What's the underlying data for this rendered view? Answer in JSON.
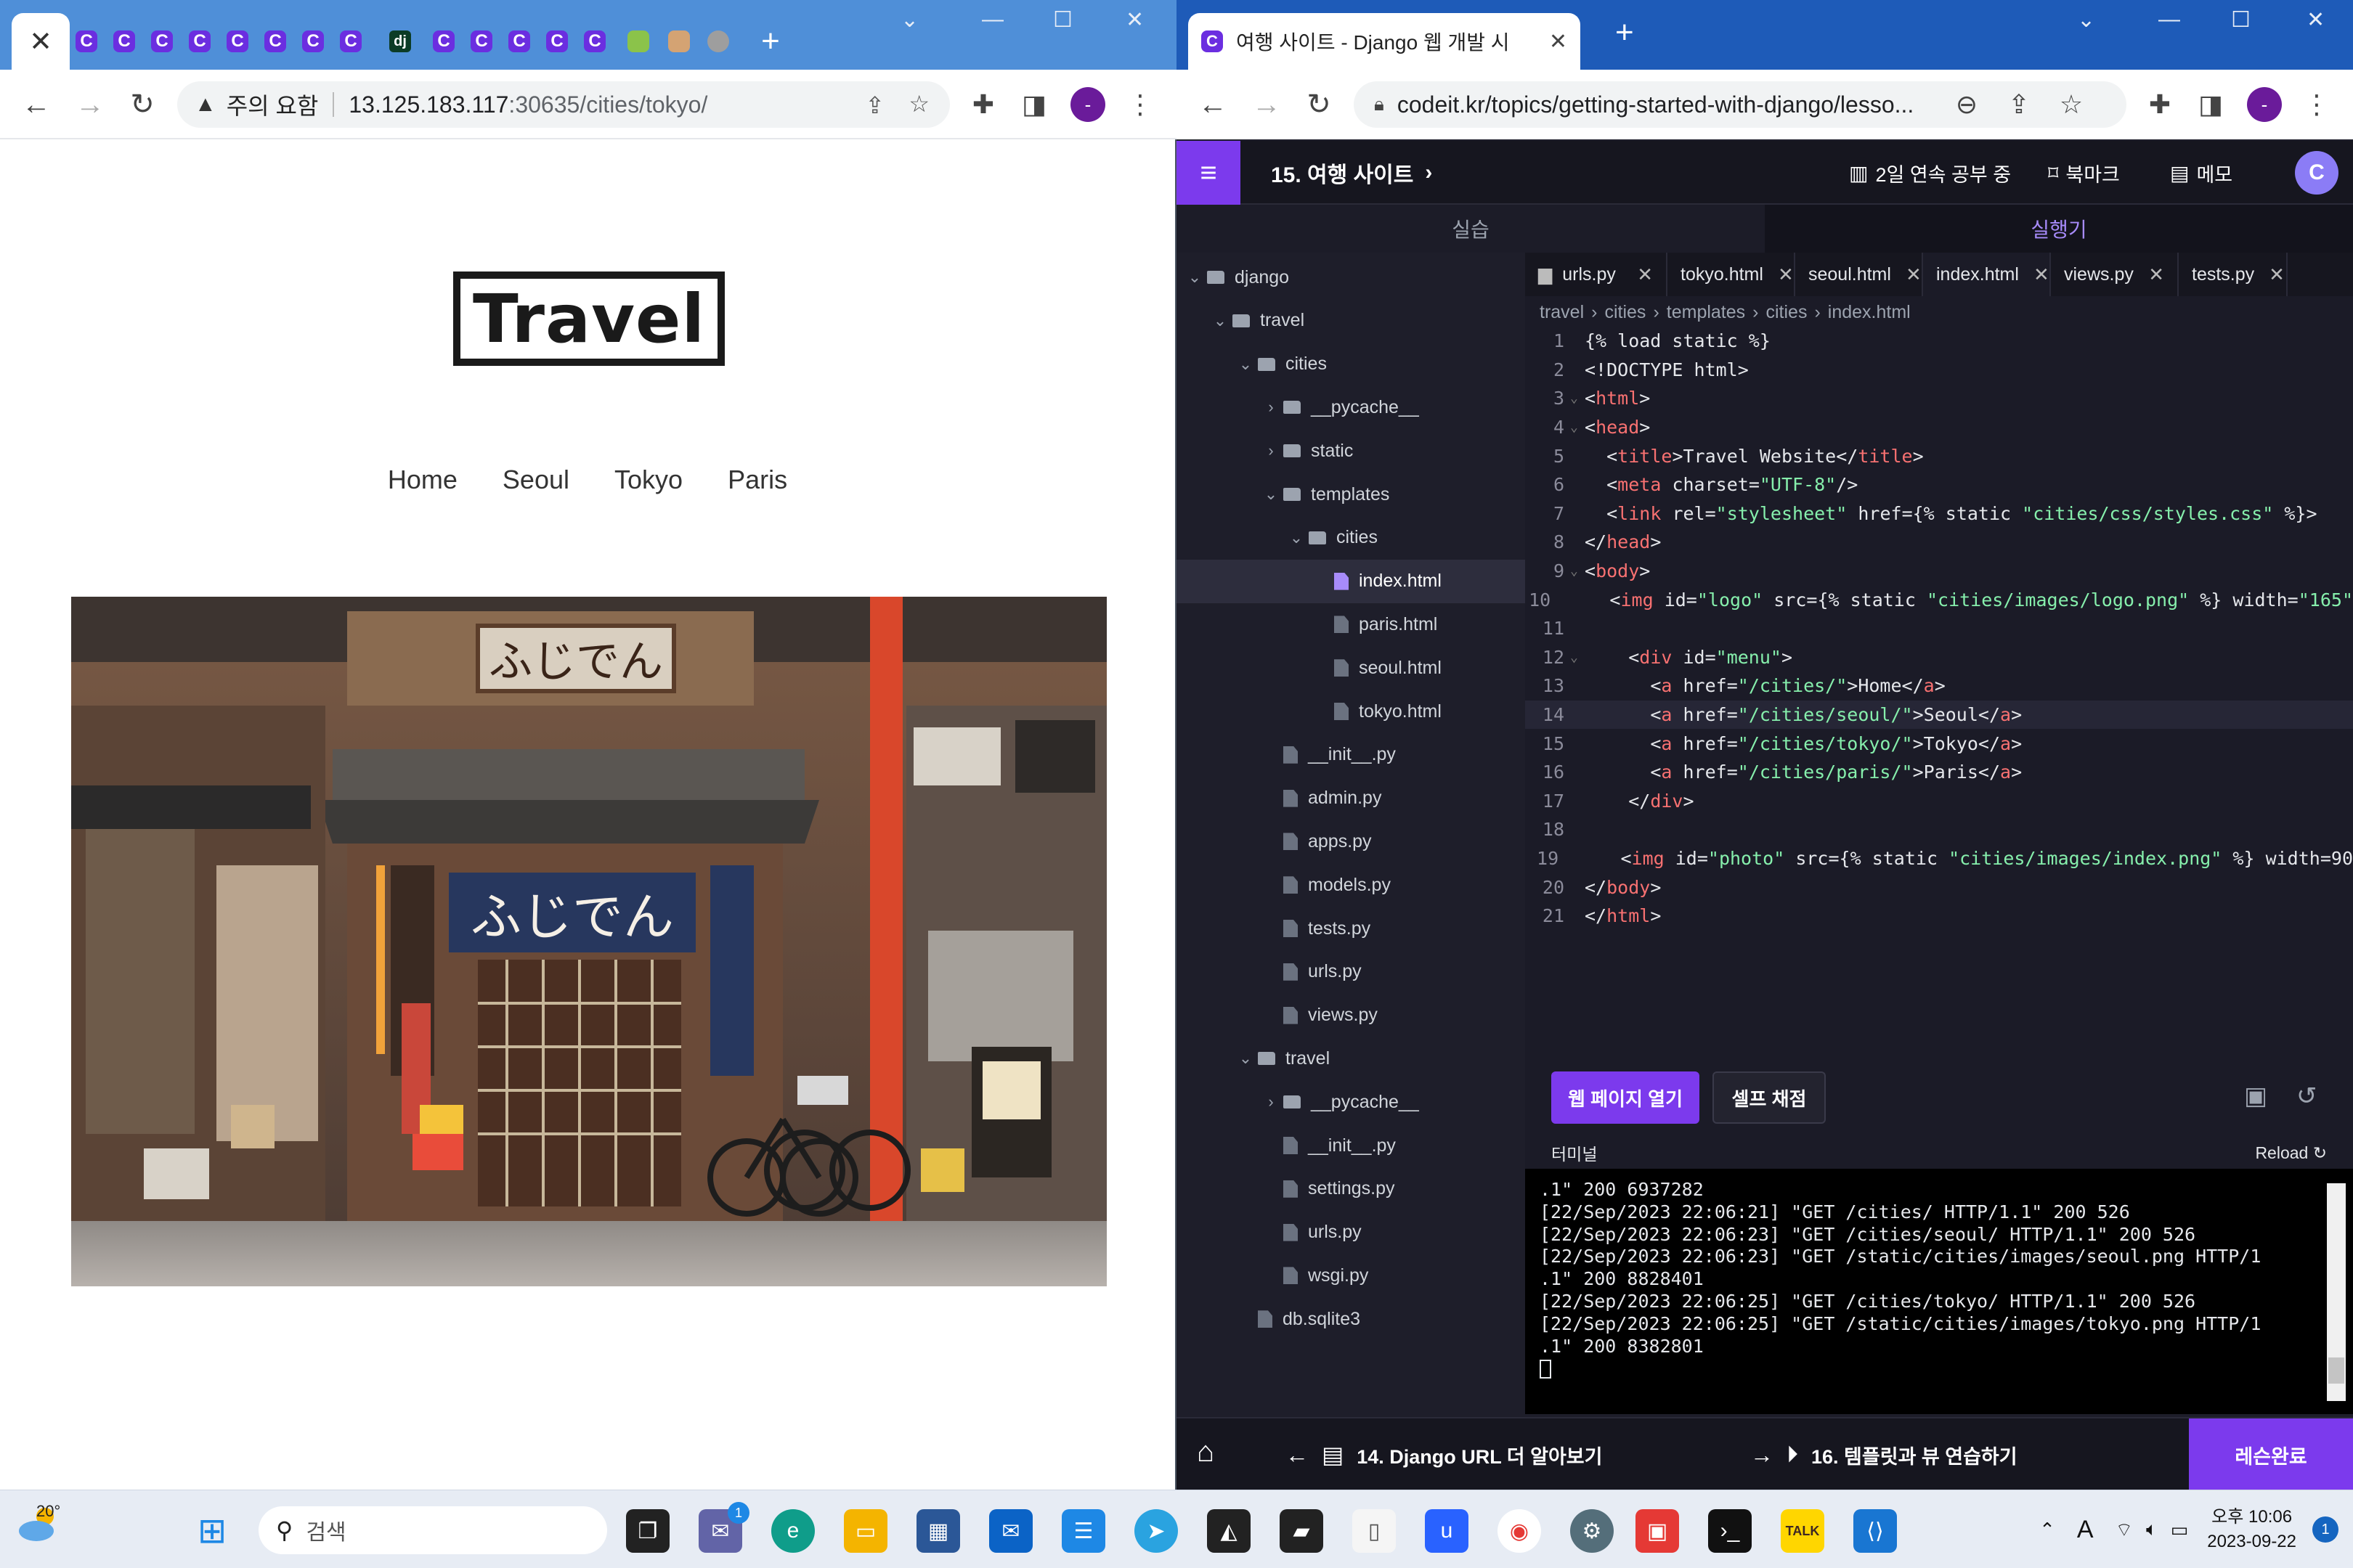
{
  "left_browser": {
    "url_warning": "주의 요함",
    "url_host": "13.125.183.117",
    "url_path": ":30635/cities/tokyo/",
    "page": {
      "logo_text": "Travel",
      "menu": [
        "Home",
        "Seoul",
        "Tokyo",
        "Paris"
      ],
      "photo_sign_top": "ふじでん",
      "photo_curtain": "ふじでん"
    }
  },
  "right_browser": {
    "tab_title": "여행 사이트 - Django 웹 개발 시",
    "url": "codeit.kr/topics/getting-started-with-django/lesso...",
    "header": {
      "lesson_title": "15. 여행 사이트",
      "streak": "2일 연속 공부 중",
      "bookmark": "북마크",
      "memo": "메모"
    },
    "modes": [
      "실습",
      "실행기"
    ],
    "tree": [
      {
        "label": "django",
        "depth": 0,
        "kind": "folder",
        "arrow": "⌄"
      },
      {
        "label": "travel",
        "depth": 1,
        "kind": "folder",
        "arrow": "⌄"
      },
      {
        "label": "cities",
        "depth": 2,
        "kind": "folder",
        "arrow": "⌄"
      },
      {
        "label": "__pycache__",
        "depth": 3,
        "kind": "folder",
        "arrow": "›"
      },
      {
        "label": "static",
        "depth": 3,
        "kind": "folder",
        "arrow": "›"
      },
      {
        "label": "templates",
        "depth": 3,
        "kind": "folder",
        "arrow": "⌄"
      },
      {
        "label": "cities",
        "depth": 4,
        "kind": "folder",
        "arrow": "⌄"
      },
      {
        "label": "index.html",
        "depth": 5,
        "kind": "html",
        "arrow": "",
        "selected": true
      },
      {
        "label": "paris.html",
        "depth": 5,
        "kind": "file",
        "arrow": ""
      },
      {
        "label": "seoul.html",
        "depth": 5,
        "kind": "file",
        "arrow": ""
      },
      {
        "label": "tokyo.html",
        "depth": 5,
        "kind": "file",
        "arrow": ""
      },
      {
        "label": "__init__.py",
        "depth": 3,
        "kind": "file",
        "arrow": ""
      },
      {
        "label": "admin.py",
        "depth": 3,
        "kind": "file",
        "arrow": ""
      },
      {
        "label": "apps.py",
        "depth": 3,
        "kind": "file",
        "arrow": ""
      },
      {
        "label": "models.py",
        "depth": 3,
        "kind": "file",
        "arrow": ""
      },
      {
        "label": "tests.py",
        "depth": 3,
        "kind": "file",
        "arrow": ""
      },
      {
        "label": "urls.py",
        "depth": 3,
        "kind": "file",
        "arrow": ""
      },
      {
        "label": "views.py",
        "depth": 3,
        "kind": "file",
        "arrow": ""
      },
      {
        "label": "travel",
        "depth": 2,
        "kind": "folder",
        "arrow": "⌄"
      },
      {
        "label": "__pycache__",
        "depth": 3,
        "kind": "folder",
        "arrow": "›"
      },
      {
        "label": "__init__.py",
        "depth": 3,
        "kind": "file",
        "arrow": ""
      },
      {
        "label": "settings.py",
        "depth": 3,
        "kind": "file",
        "arrow": ""
      },
      {
        "label": "urls.py",
        "depth": 3,
        "kind": "file",
        "arrow": ""
      },
      {
        "label": "wsgi.py",
        "depth": 3,
        "kind": "file",
        "arrow": ""
      },
      {
        "label": "db.sqlite3",
        "depth": 2,
        "kind": "file",
        "arrow": ""
      }
    ],
    "editor_tabs": [
      "urls.py",
      "tokyo.html",
      "seoul.html",
      "index.html",
      "views.py",
      "tests.py"
    ],
    "breadcrumb": [
      "travel",
      "cities",
      "templates",
      "cities",
      "index.html"
    ],
    "code_lines": [
      "{% load static %}",
      "<!DOCTYPE html>",
      "<html>",
      "<head>",
      "  <title>Travel Website</title>",
      "  <meta charset=\"UTF-8\"/>",
      "  <link rel=\"stylesheet\" href={% static \"cities/css/styles.css\" %}>",
      "</head>",
      "<body>",
      "    <img id=\"logo\" src={% static \"cities/images/logo.png\" %} width=\"165\"",
      "",
      "    <div id=\"menu\">",
      "      <a href=\"/cities/\">Home</a>",
      "      <a href=\"/cities/seoul/\">Seoul</a>",
      "      <a href=\"/cities/tokyo/\">Tokyo</a>",
      "      <a href=\"/cities/paris/\">Paris</a>",
      "    </div>",
      "",
      "    <img id=\"photo\" src={% static \"cities/images/index.png\" %} width=\"90",
      "</body>",
      "</html>"
    ],
    "actions": {
      "open_page": "웹 페이지 열기",
      "self_grade": "셀프 채점"
    },
    "terminal_label": "터미널",
    "reload_label": "Reload",
    "terminal_lines": [
      ".1\" 200 6937282",
      "[22/Sep/2023 22:06:21] \"GET /cities/ HTTP/1.1\" 200 526",
      "[22/Sep/2023 22:06:23] \"GET /cities/seoul/ HTTP/1.1\" 200 526",
      "[22/Sep/2023 22:06:23] \"GET /static/cities/images/seoul.png HTTP/1",
      ".1\" 200 8828401",
      "[22/Sep/2023 22:06:25] \"GET /cities/tokyo/ HTTP/1.1\" 200 526",
      "[22/Sep/2023 22:06:25] \"GET /static/cities/images/tokyo.png HTTP/1",
      ".1\" 200 8382801"
    ],
    "bottom": {
      "prev": "14. Django URL 더 알아보기",
      "next": "16. 템플릿과 뷰 연습하기",
      "done": "레슨완료"
    }
  },
  "taskbar": {
    "temperature": "20°",
    "search_placeholder": "검색",
    "chat_badge": "1",
    "clock_time": "오후 10:06",
    "clock_date": "2023-09-22",
    "notification_count": "1",
    "ime": "A"
  },
  "colors": {
    "accent": "#7c3aed",
    "left_tabbar": "#4f8fd8",
    "right_tabbar": "#1e5bb8"
  }
}
